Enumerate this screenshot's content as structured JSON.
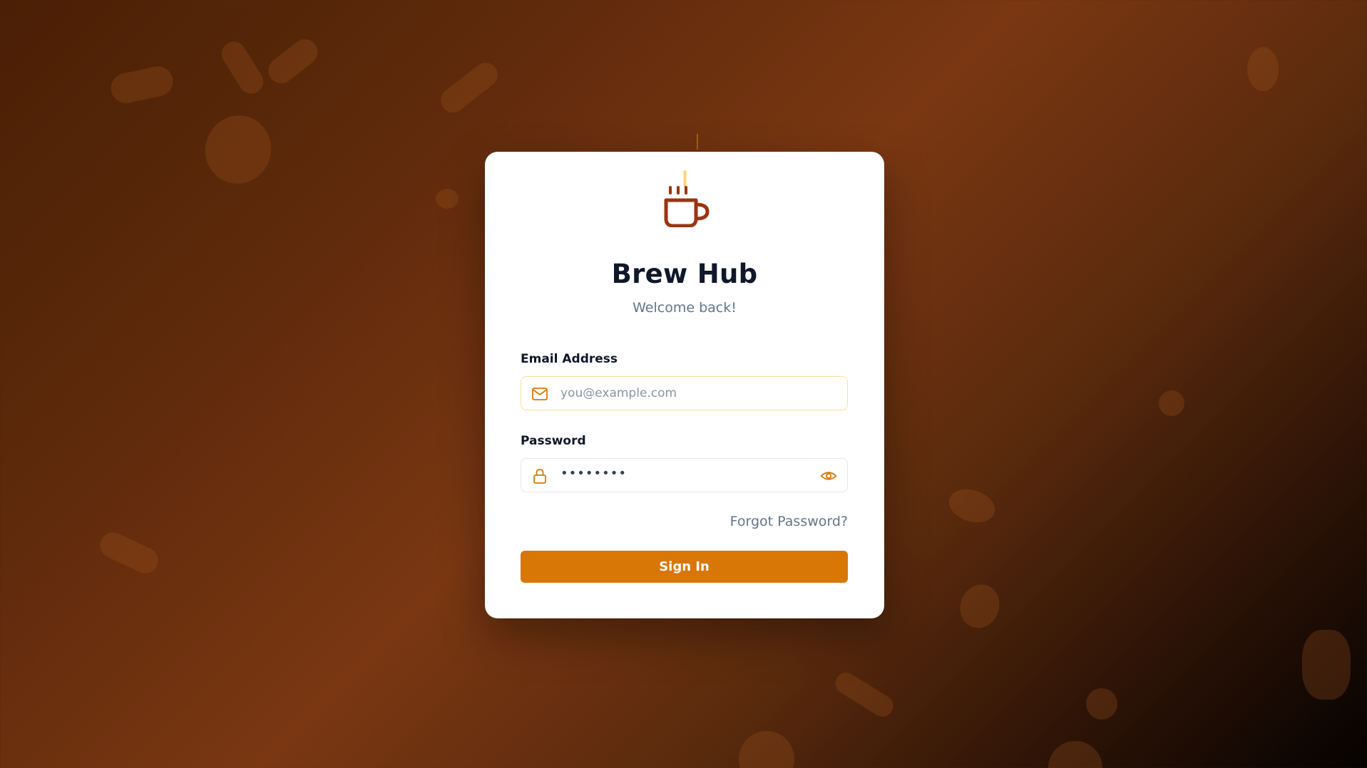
{
  "app": {
    "title": "Brew Hub",
    "subtitle": "Welcome back!"
  },
  "login_form": {
    "email_label": "Email Address",
    "email_placeholder": "you@example.com",
    "email_value": "",
    "password_label": "Password",
    "password_value_masked": "••••••••",
    "forgot_password_label": "Forgot Password?",
    "signin_label": "Sign In"
  },
  "icons": {
    "logo": "coffee-cup-icon",
    "email": "mail-icon",
    "password": "lock-icon",
    "reveal": "eye-icon"
  },
  "colors": {
    "accent": "#d97706",
    "logo_brown": "#9a3412",
    "title_text": "#0f172a",
    "muted_text": "#64748b",
    "card_background": "#ffffff"
  }
}
